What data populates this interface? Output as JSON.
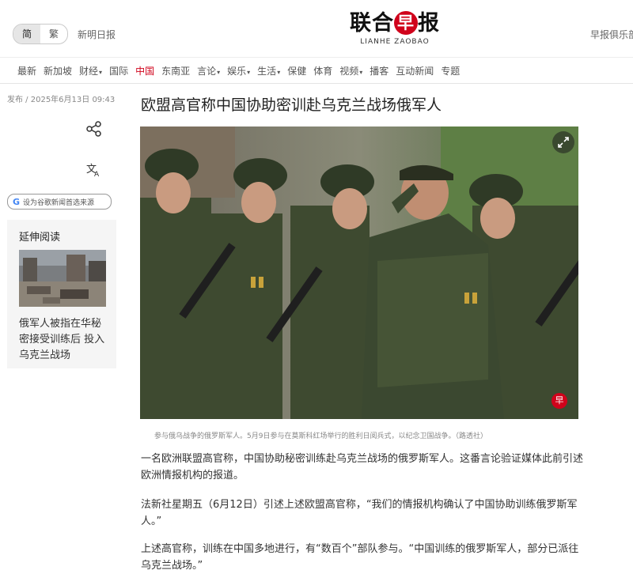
{
  "header": {
    "toggle_simplified": "简",
    "toggle_traditional": "繁",
    "xinming_link": "新明日报",
    "logo_cn_left": "联合",
    "logo_cn_mark": "早",
    "logo_cn_right": "报",
    "logo_en": "LIANHE ZAOBAO",
    "club_link": "早报俱乐部"
  },
  "nav": {
    "items": [
      {
        "label": "最新"
      },
      {
        "label": "新加坡"
      },
      {
        "label": "财经",
        "caret": "▾"
      },
      {
        "label": "国际"
      },
      {
        "label": "中国",
        "active": true
      },
      {
        "label": "东南亚"
      },
      {
        "label": "言论",
        "caret": "▾"
      },
      {
        "label": "娱乐",
        "caret": "▾"
      },
      {
        "label": "生活",
        "caret": "▾"
      },
      {
        "label": "保健"
      },
      {
        "label": "体育"
      },
      {
        "label": "视频",
        "caret": "▾"
      },
      {
        "label": "播客"
      },
      {
        "label": "互动新闻"
      },
      {
        "label": "专题"
      }
    ]
  },
  "sidebar": {
    "pubdate": "发布 / 2025年6月13日 09:43",
    "google_pill": "设为谷歌新闻首选来源",
    "google_g": "G",
    "related_title": "延伸阅读",
    "related_article": "俄军人被指在华秘密接受训练后 投入乌克兰战场"
  },
  "article": {
    "headline": "欧盟高官称中国协助密训赴乌克兰战场俄军人",
    "photo_mark": "早",
    "caption": "参与俄乌战争的俄罗斯军人。5月9日参与在莫斯科红场举行的胜利日阅兵式，以纪念卫国战争。（路透社）",
    "paragraphs": [
      "一名欧洲联盟高官称，中国协助秘密训练赴乌克兰战场的俄罗斯军人。这番言论验证媒体此前引述欧洲情报机构的报道。",
      "法新社星期五（6月12日）引述上述欧盟高官称，“我们的情报机构确认了中国协助训练俄罗斯军人。”",
      "上述高官称，训练在中国多地进行，有“数百个”部队参与。“中国训练的俄罗斯军人，部分已派往乌克兰战场。”"
    ]
  },
  "icons": {
    "share": "share-icon",
    "translate": "translate-icon",
    "expand": "expand-icon"
  },
  "colors": {
    "accent": "#d0021b",
    "nav_active": "#d0021b"
  }
}
